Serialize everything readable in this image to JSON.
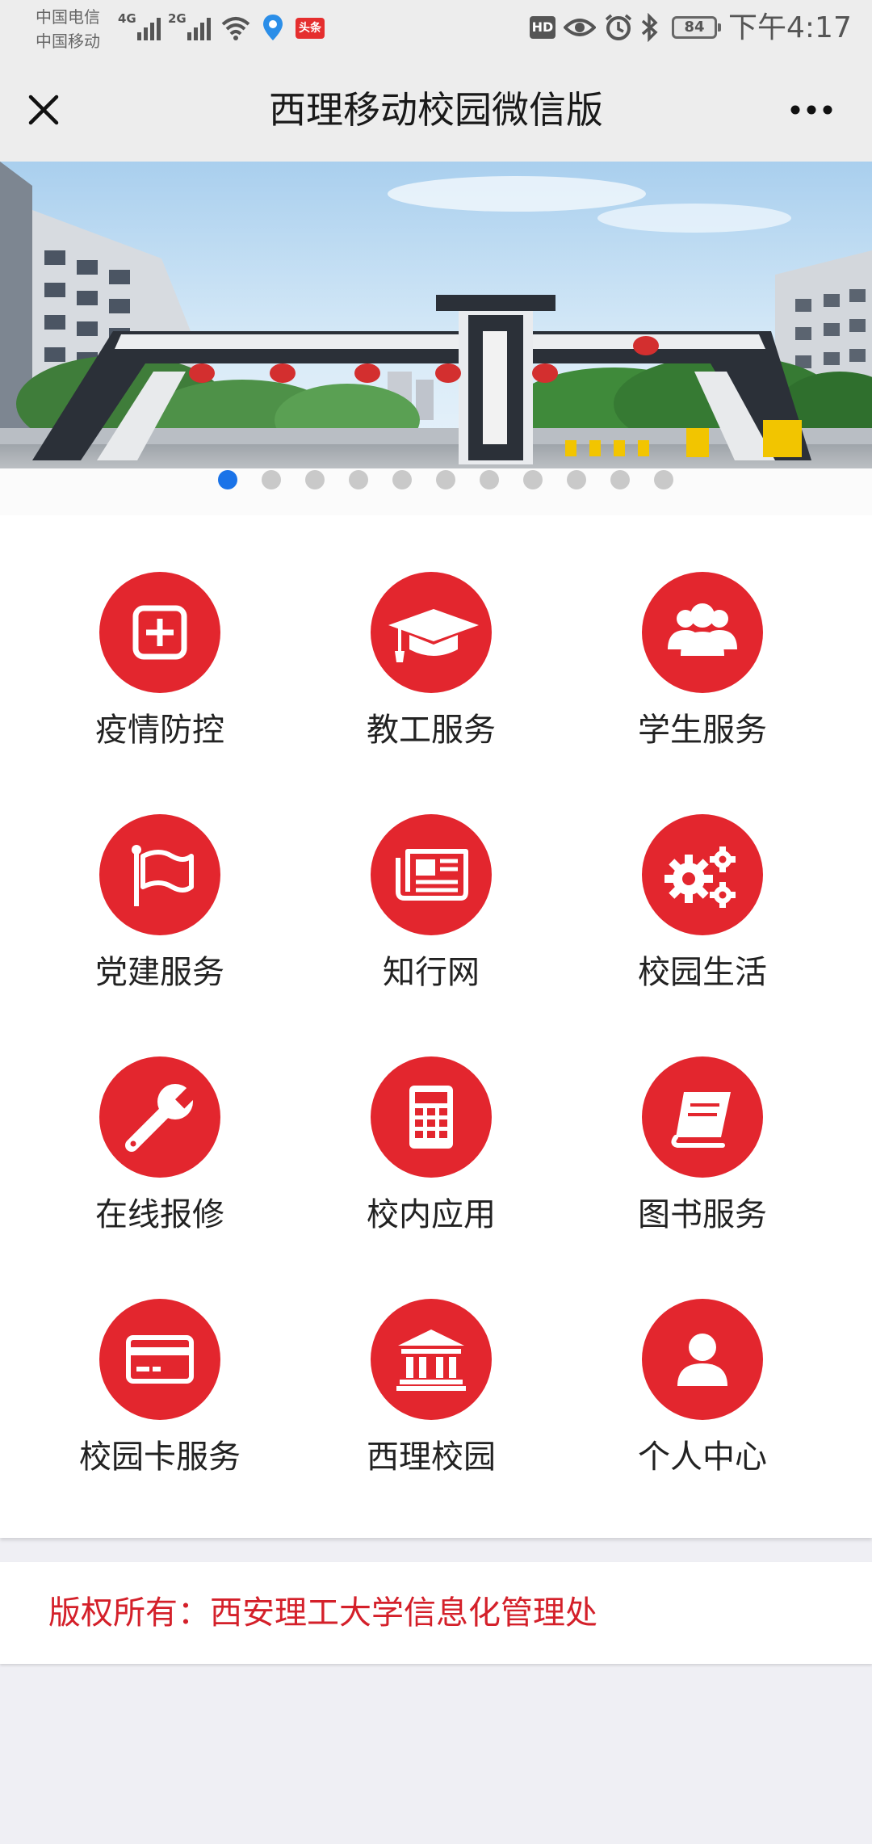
{
  "status_bar": {
    "carrier_1": "中国电信",
    "carrier_2": "中国移动",
    "network_1": "4G",
    "network_2": "2G",
    "hd_label": "HD",
    "news_badge": "头条",
    "battery_level": "84",
    "time": "下午4:17"
  },
  "nav": {
    "title": "西理移动校园微信版",
    "close_icon": "close-icon",
    "more_icon": "more-icon"
  },
  "banner": {
    "slide_count": 11,
    "active_index": 0
  },
  "menu": [
    {
      "label": "疫情防控",
      "icon": "medical-plus-icon"
    },
    {
      "label": "教工服务",
      "icon": "graduation-cap-icon"
    },
    {
      "label": "学生服务",
      "icon": "users-group-icon"
    },
    {
      "label": "党建服务",
      "icon": "flag-icon"
    },
    {
      "label": "知行网",
      "icon": "newspaper-icon"
    },
    {
      "label": "校园生活",
      "icon": "gears-icon"
    },
    {
      "label": "在线报修",
      "icon": "wrench-icon"
    },
    {
      "label": "校内应用",
      "icon": "calculator-icon"
    },
    {
      "label": "图书服务",
      "icon": "book-icon"
    },
    {
      "label": "校园卡服务",
      "icon": "credit-card-icon"
    },
    {
      "label": "西理校园",
      "icon": "university-building-icon"
    },
    {
      "label": "个人中心",
      "icon": "user-icon"
    }
  ],
  "footer": {
    "copyright": "版权所有：西安理工大学信息化管理处"
  },
  "colors": {
    "accent_red": "#e3262e",
    "copyright_red": "#d4202a",
    "active_dot": "#1a73e8"
  }
}
